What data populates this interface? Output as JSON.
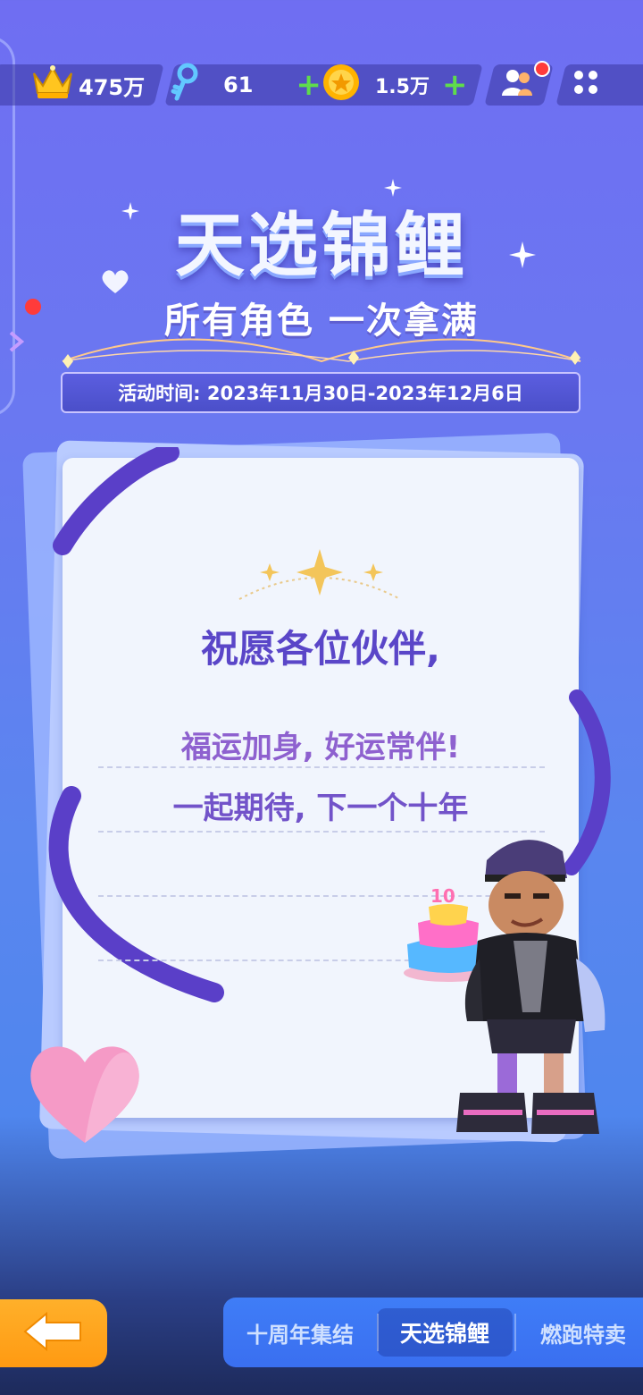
{
  "topbar": {
    "crown_value": "475万",
    "key_value": "61",
    "coin_value": "1.5万",
    "plus_symbol": "+"
  },
  "event": {
    "title": "天选锦鲤",
    "subtitle": "所有角色  一次拿满",
    "date_text": "活动时间: 2023年11月30日-2023年12月6日"
  },
  "card": {
    "greeting": "祝愿各位伙伴,",
    "line1": "福运加身, 好运常伴!",
    "line2": "一起期待, 下一个十年"
  },
  "cake": {
    "number": "10"
  },
  "nav": {
    "tabs": [
      "十周年集结",
      "天选锦鲤",
      "燃跑特卖"
    ],
    "active_tab": "天选锦鲤"
  },
  "colors": {
    "accent": "#5a46c8",
    "tab_bar": "#3f7df7",
    "back_button": "#ffa41e",
    "plus": "#5fdc4c"
  },
  "icons": [
    "crown-icon",
    "key-icon",
    "coin-icon",
    "friends-icon",
    "menu-grid-icon",
    "back-arrow-icon",
    "heart-icon",
    "sparkle-icon"
  ]
}
